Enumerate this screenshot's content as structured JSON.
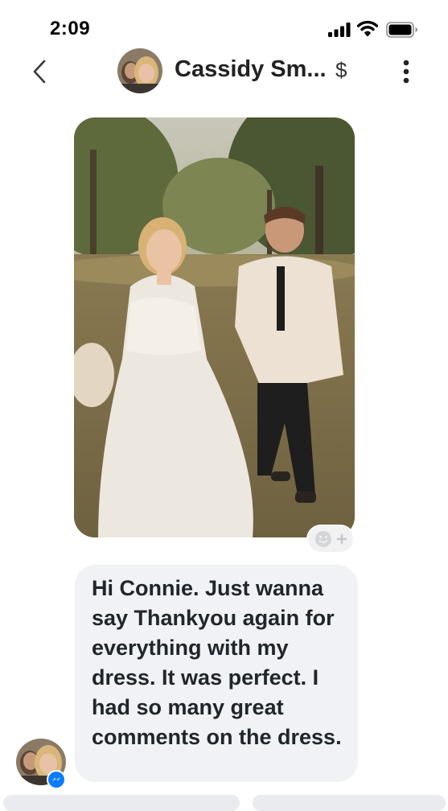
{
  "status_bar": {
    "time": "2:09"
  },
  "header": {
    "contact_name": "Cassidy Sm...",
    "currency_symbol": "$"
  },
  "message": {
    "text": "Hi Connie. Just wanna say Thankyou again for everything with my dress. It was perfect. I had so many great comments on the dress."
  },
  "colors": {
    "bubble": "#f0f2f5",
    "text": "#22262b",
    "messenger_blue": "#0a7cff"
  },
  "icons": [
    "back-chevron-icon",
    "more-vertical-icon",
    "add-reaction-icon",
    "messenger-icon",
    "cellular-signal-icon",
    "wifi-icon",
    "battery-icon"
  ]
}
